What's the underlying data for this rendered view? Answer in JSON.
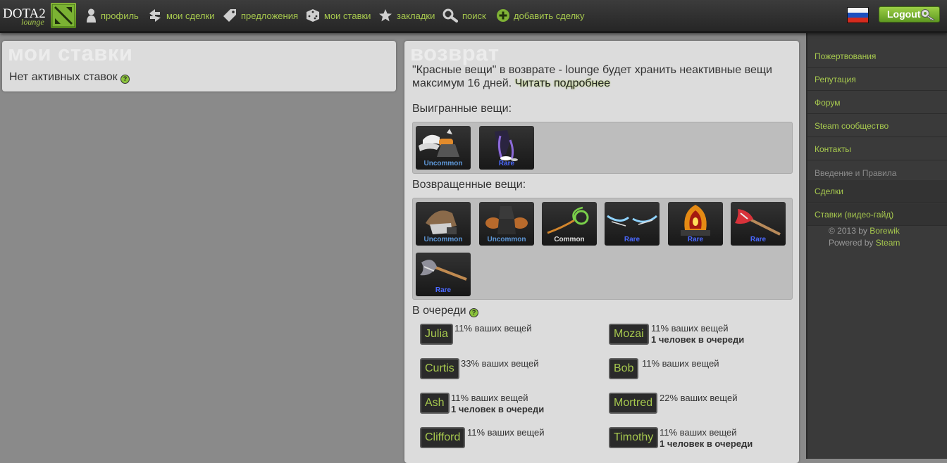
{
  "header": {
    "logo_text": "DOTA2",
    "logo_sub": "lounge",
    "nav": [
      {
        "label": "профиль",
        "icon": "profile-icon"
      },
      {
        "label": "мои сделки",
        "icon": "trades-icon"
      },
      {
        "label": "предложения",
        "icon": "tag-icon"
      },
      {
        "label": "мои ставки",
        "icon": "dice-icon"
      },
      {
        "label": "закладки",
        "icon": "star-icon"
      },
      {
        "label": "поиск",
        "icon": "search-icon"
      },
      {
        "label": "добавить сделку",
        "icon": "plus-icon"
      }
    ],
    "logout_label": "Logout",
    "flag": "russia-flag"
  },
  "my_bets": {
    "title": "мои ставки",
    "empty_text": "Нет активных ставок"
  },
  "returns": {
    "title": "возврат",
    "description": "\"Красные вещи\" в возврате - lounge будет хранить неактивные вещи максимум 16 дней.",
    "read_more": "Читать подробнее",
    "won_label": "Выигранные вещи:",
    "won_items": [
      {
        "rarity": "Uncommon"
      },
      {
        "rarity": "Rare"
      }
    ],
    "returned_label": "Возвращенные вещи:",
    "returned_items": [
      {
        "rarity": "Uncommon"
      },
      {
        "rarity": "Uncommon"
      },
      {
        "rarity": "Common"
      },
      {
        "rarity": "Rare"
      },
      {
        "rarity": "Rare"
      },
      {
        "rarity": "Rare"
      },
      {
        "rarity": "Rare"
      }
    ],
    "queue_label": "В очереди",
    "queue": [
      {
        "name": "Julia",
        "pct": "11% ваших вещей",
        "note": ""
      },
      {
        "name": "Mozai",
        "pct": "11% ваших вещей",
        "note": "1 человек в очереди"
      },
      {
        "name": "Curtis",
        "pct": "33% ваших вещей",
        "note": ""
      },
      {
        "name": "Bob",
        "pct": "11% ваших вещей",
        "note": ""
      },
      {
        "name": "Ash",
        "pct": "11% ваших вещей",
        "note": "1 человек в очереди"
      },
      {
        "name": "Mortred",
        "pct": "22% ваших вещей",
        "note": ""
      },
      {
        "name": "Clifford",
        "pct": "11% ваших вещей",
        "note": ""
      },
      {
        "name": "Timothy",
        "pct": "11% ваших вещей",
        "note": "1 человек в очереди"
      }
    ]
  },
  "sidebar": {
    "items": [
      {
        "label": "Пожертвования"
      },
      {
        "label": "Репутация"
      },
      {
        "label": "Форум"
      },
      {
        "label": "Steam сообщество"
      },
      {
        "label": "Контакты"
      }
    ],
    "section_title": "Введение и Правила",
    "guide_items": [
      {
        "label": "Сделки"
      },
      {
        "label": "Ставки (видео-гайд)"
      }
    ],
    "footer_copyright": "© 2013 by",
    "footer_author": "Borewik",
    "footer_powered": "Powered by",
    "footer_steam": "Steam"
  },
  "colors": {
    "accent": "#a7c94e",
    "uncommon": "#5e98d9",
    "rare": "#4b69ff",
    "common": "#e0e0e0"
  }
}
